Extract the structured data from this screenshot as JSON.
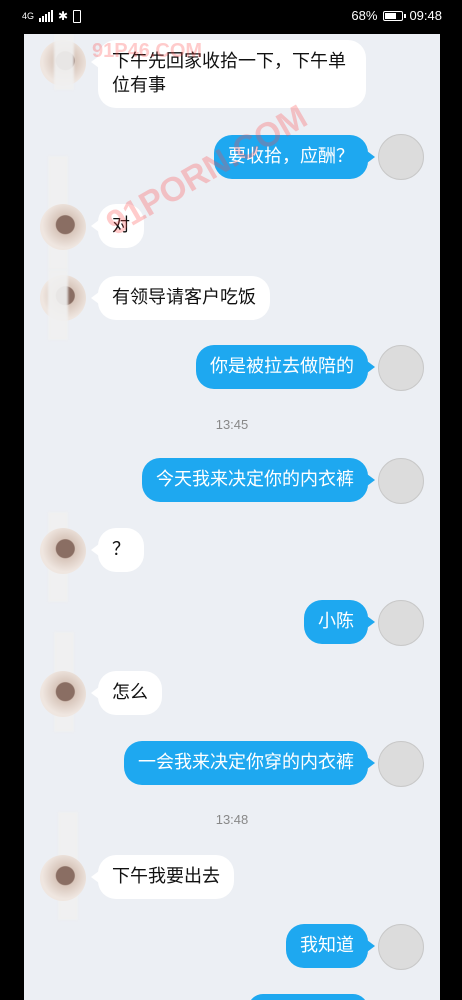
{
  "status_bar": {
    "network": "4G",
    "battery_percent": "68%",
    "battery_level": 0.68,
    "time": "09:48",
    "icons": [
      "signal-icon",
      "bluetooth-icon",
      "vibrate-icon",
      "battery-icon"
    ]
  },
  "watermarks": [
    "91P46.COM",
    "91PORN.COM",
    "91PORN.COM"
  ],
  "messages": [
    {
      "side": "in",
      "text": "下午先回家收拾一下，下午单位有事"
    },
    {
      "side": "out",
      "text": "要收拾，应酬？"
    },
    {
      "side": "in",
      "text": "对"
    },
    {
      "side": "in",
      "text": "有领导请客户吃饭"
    },
    {
      "side": "out",
      "text": "你是被拉去做陪的"
    },
    {
      "side": "time",
      "text": "13:45"
    },
    {
      "side": "out",
      "text": "今天我来决定你的内衣裤"
    },
    {
      "side": "in",
      "text": "？"
    },
    {
      "side": "out",
      "text": "小陈"
    },
    {
      "side": "in",
      "text": "怎么"
    },
    {
      "side": "out",
      "text": "一会我来决定你穿的内衣裤"
    },
    {
      "side": "time",
      "text": "13:48"
    },
    {
      "side": "in",
      "text": "下午我要出去"
    },
    {
      "side": "out",
      "text": "我知道"
    }
  ],
  "colors": {
    "outgoing_bubble": "#1ea8f0",
    "incoming_bubble": "#ffffff",
    "chat_background": "#eceff4"
  }
}
